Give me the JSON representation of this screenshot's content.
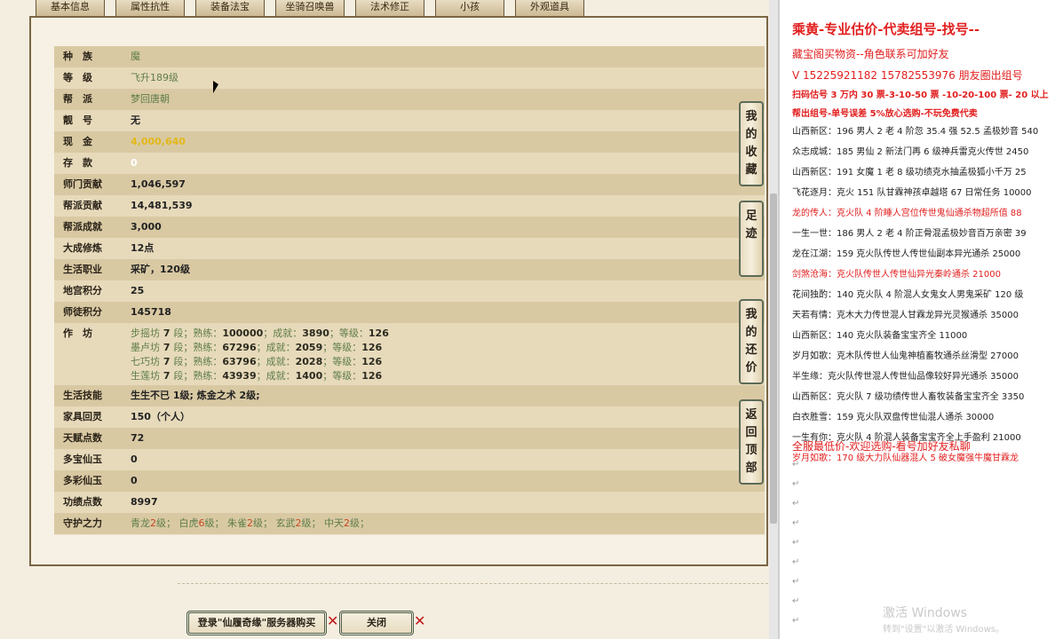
{
  "tabs": [
    "基本信息",
    "属性抗性",
    "装备法宝",
    "坐骑召唤兽",
    "法术修正",
    "小孩",
    "外观道具"
  ],
  "rows": [
    {
      "label": "种　族",
      "value": "魔",
      "style": "green"
    },
    {
      "label": "等　级",
      "value": "飞升189级",
      "style": "green"
    },
    {
      "label": "帮　派",
      "value": "梦回唐朝",
      "style": "green"
    },
    {
      "label": "靓　号",
      "value": "无",
      "style": "dark"
    },
    {
      "label": "现　金",
      "value": "4,000,640",
      "style": "gold"
    },
    {
      "label": "存　款",
      "value": "0",
      "style": "white"
    },
    {
      "label": "师门贡献",
      "value": "1,046,597",
      "style": "dark"
    },
    {
      "label": "帮派贡献",
      "value": "14,481,539",
      "style": "dark"
    },
    {
      "label": "帮派成就",
      "value": "3,000",
      "style": "dark"
    },
    {
      "label": "大成修炼",
      "value": "12点",
      "style": "dark"
    },
    {
      "label": "生活职业",
      "value": "采矿，120级",
      "style": "dark"
    },
    {
      "label": "地宫积分",
      "value": "25",
      "style": "dark"
    }
  ],
  "row_master": {
    "label": "师徒积分",
    "value": "145718"
  },
  "workshop": {
    "label": "作　坊",
    "lines": [
      {
        "name": "步摇坊",
        "level": "7",
        "level_unit": "段",
        "skill_label": "熟练",
        "skill": "100000",
        "ach_label": "成就",
        "ach": "3890",
        "grade_label": "等级",
        "grade": "126"
      },
      {
        "name": "墨卢坊",
        "level": "7",
        "level_unit": "段",
        "skill_label": "熟练",
        "skill": "67296",
        "ach_label": "成就",
        "ach": "2059",
        "grade_label": "等级",
        "grade": "126"
      },
      {
        "name": "七巧坊",
        "level": "7",
        "level_unit": "段",
        "skill_label": "熟练",
        "skill": "63796",
        "ach_label": "成就",
        "ach": "2028",
        "grade_label": "等级",
        "grade": "126"
      },
      {
        "name": "生莲坊",
        "level": "7",
        "level_unit": "段",
        "skill_label": "熟练",
        "skill": "43939",
        "ach_label": "成就",
        "ach": "1400",
        "grade_label": "等级",
        "grade": "126"
      }
    ]
  },
  "rows2": [
    {
      "label": "生活技能",
      "value": "生生不已 1级; 炼金之术 2级;",
      "style": "dark"
    },
    {
      "label": "家具回灵",
      "value": "150（个人）",
      "style": "dark"
    },
    {
      "label": "天赋点数",
      "value": "72",
      "style": "dark"
    },
    {
      "label": "多宝仙玉",
      "value": "0",
      "style": "dark"
    },
    {
      "label": "多彩仙玉",
      "value": "0",
      "style": "dark"
    },
    {
      "label": "功绩点数",
      "value": "8997",
      "style": "dark"
    }
  ],
  "guard": {
    "label": "守护之力",
    "items": [
      {
        "name": "青龙",
        "level": "2",
        "unit": "级"
      },
      {
        "name": "白虎",
        "level": "6",
        "unit": "级"
      },
      {
        "name": "朱雀",
        "level": "2",
        "unit": "级"
      },
      {
        "name": "玄武",
        "level": "2",
        "unit": "级"
      },
      {
        "name": "中天",
        "level": "2",
        "unit": "级"
      }
    ]
  },
  "side_buttons": [
    {
      "label": "我的收藏"
    },
    {
      "label": "足迹"
    },
    {
      "label": "我的还价"
    },
    {
      "label": "返回顶部"
    }
  ],
  "buttons": {
    "login": "登录\"仙履奇缘\"服务器购买",
    "close": "关闭",
    "x": "✕"
  },
  "right": {
    "title": "乘黄-专业估价-代卖组号-找号--",
    "ad1": "藏宝阁买物资--角色联系可加好友",
    "ad2": "V 15225921182    15782553976 朋友圈出组号",
    "ad3": "扫码估号 3 万内 30 票-3-10-50 票  -10-20-100 票- 20 以上",
    "ad4": "帮出组号-单号误差 5%放心选购-不玩免费代卖",
    "listings": [
      {
        "text": "山西新区：196 男人 2 老 4 阶忽 35.4 强 52.5 孟极妙音 540",
        "red": false
      },
      {
        "text": "众志成城：185 男仙 2 新法门再 6 级神兵雷克火传世 2450",
        "red": false
      },
      {
        "text": "山西新区：191 女魔 1 老 8 级功绩克水抽孟极狐小千万 25",
        "red": false
      },
      {
        "text": "飞花逐月：克火 151 队甘霖神孩卓越塔 67 日常任务 10000",
        "red": false
      },
      {
        "text": "龙的传人：克火队 4 阶睡人宫位传世鬼仙通杀物超所值 88",
        "red": true
      },
      {
        "text": "一生一世：186 男人 2 老 4 阶正骨混孟极妙音百万亲密 39",
        "red": false
      },
      {
        "text": "龙在江湖：159 克火队传世人传世仙副本异光通杀 25000",
        "red": false
      },
      {
        "text": "剑煞沧海：克火队传世人传世仙异光秦岭通杀 21000",
        "red": true
      },
      {
        "text": "花间独酌：140 克火队 4 阶混人女鬼女人男鬼采矿 120 级",
        "red": false
      },
      {
        "text": "天若有情：克木大力传世混人甘霖龙异光灵猴通杀 35000",
        "red": false
      },
      {
        "text": "山西新区：140 克火队装备宝宝齐全 11000",
        "red": false
      },
      {
        "text": "岁月如歌：克木队传世人仙鬼神植畜牧通杀丝滑型 27000",
        "red": false
      },
      {
        "text": "半生缘：克火队传世混人传世仙品像较好异光通杀 35000",
        "red": false
      },
      {
        "text": "山西新区：克火队 7 级功绩传世人畜牧装备宝宝齐全 3350",
        "red": false
      },
      {
        "text": "白衣胜雪：159 克火队双盘传世仙混人通杀 30000",
        "red": false
      },
      {
        "text": "一生有你：克火队 4 阶混人装备宝宝齐全上手盈利 21000",
        "red": false
      },
      {
        "text": "岁月如歌：170 级大力队仙器混人 5 破女魔强牛魔甘霖龙",
        "red": true
      }
    ],
    "footer": "全服最低价-欢迎选购-看号加好友私聊",
    "mark": "↵",
    "watermark1": "激活 Windows",
    "watermark2": "转到\"设置\"以激活 Windows。"
  }
}
